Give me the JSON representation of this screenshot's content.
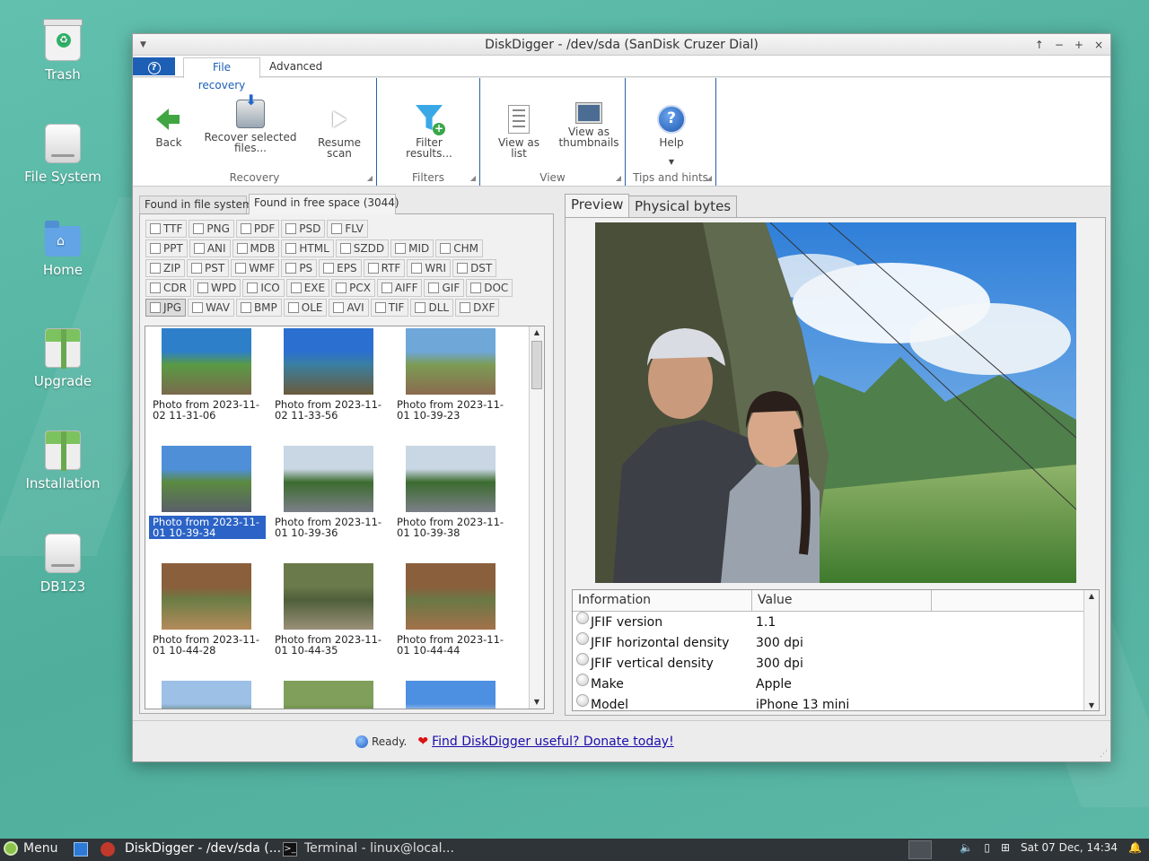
{
  "desktop": {
    "icons": [
      {
        "label": "Trash"
      },
      {
        "label": "File System"
      },
      {
        "label": "Home"
      },
      {
        "label": "Upgrade"
      },
      {
        "label": "Installation"
      },
      {
        "label": "DB123"
      }
    ]
  },
  "window": {
    "title": "DiskDigger - /dev/sda (SanDisk Cruzer Dial)",
    "controls": {
      "shade": "↑",
      "minimize": "−",
      "maximize": "+",
      "close": "×"
    }
  },
  "ribbon": {
    "help_tab": "?",
    "tabs": [
      "File recovery",
      "Advanced"
    ],
    "groups": {
      "recovery": {
        "label": "Recovery",
        "back": "Back",
        "recover_selected": "Recover selected files...",
        "resume_scan": "Resume scan"
      },
      "filters": {
        "label": "Filters",
        "filter_results": "Filter results..."
      },
      "view": {
        "label": "View",
        "view_as_list": "View as list",
        "view_as_thumbnails": "View as thumbnails"
      },
      "tips": {
        "label": "Tips and hints",
        "help": "Help"
      }
    }
  },
  "left": {
    "tabs": [
      "Found in file system",
      "Found in free space (3044)"
    ],
    "type_rows": [
      [
        "TTF",
        "PNG",
        "PDF",
        "PSD",
        "FLV"
      ],
      [
        "PPT",
        "ANI",
        "MDB",
        "HTML",
        "SZDD",
        "MID",
        "CHM"
      ],
      [
        "ZIP",
        "PST",
        "WMF",
        "PS",
        "EPS",
        "RTF",
        "WRI",
        "DST"
      ],
      [
        "CDR",
        "WPD",
        "ICO",
        "EXE",
        "PCX",
        "AIFF",
        "GIF",
        "DOC"
      ],
      [
        "JPG",
        "WAV",
        "BMP",
        "OLE",
        "AVI",
        "TIF",
        "DLL",
        "DXF"
      ]
    ],
    "selected_type": "JPG",
    "thumbnails": [
      {
        "caption": "Photo from 2023-11-02 11-31-06"
      },
      {
        "caption": "Photo from 2023-11-02 11-33-56"
      },
      {
        "caption": "Photo from 2023-11-01 10-39-23"
      },
      {
        "caption": "Photo from 2023-11-01 10-39-34",
        "selected": true
      },
      {
        "caption": "Photo from 2023-11-01 10-39-36"
      },
      {
        "caption": "Photo from 2023-11-01 10-39-38"
      },
      {
        "caption": "Photo from 2023-11-01 10-44-28"
      },
      {
        "caption": "Photo from 2023-11-01 10-44-35"
      },
      {
        "caption": "Photo from 2023-11-01 10-44-44"
      },
      {
        "caption": ""
      },
      {
        "caption": ""
      },
      {
        "caption": ""
      }
    ]
  },
  "right": {
    "tabs": [
      "Preview",
      "Physical bytes"
    ],
    "info_headers": [
      "Information",
      "Value"
    ],
    "info_rows": [
      {
        "key": "JFIF version",
        "value": "1.1"
      },
      {
        "key": "JFIF horizontal density",
        "value": "300 dpi"
      },
      {
        "key": "JFIF vertical density",
        "value": "300 dpi"
      },
      {
        "key": "Make",
        "value": "Apple"
      },
      {
        "key": "Model",
        "value": "iPhone 13 mini"
      }
    ]
  },
  "status": {
    "text": "Ready.",
    "donate": "Find DiskDigger useful? Donate today!"
  },
  "taskbar": {
    "menu": "Menu",
    "windows": [
      "DiskDigger - /dev/sda (...",
      "Terminal - linux@local..."
    ],
    "clock": "Sat 07 Dec, 14:34"
  },
  "colors": {
    "accent": "#1c5fb5",
    "selection": "#2b63c6",
    "desktop": "#5bb8a8",
    "taskbar": "#2f3438"
  }
}
